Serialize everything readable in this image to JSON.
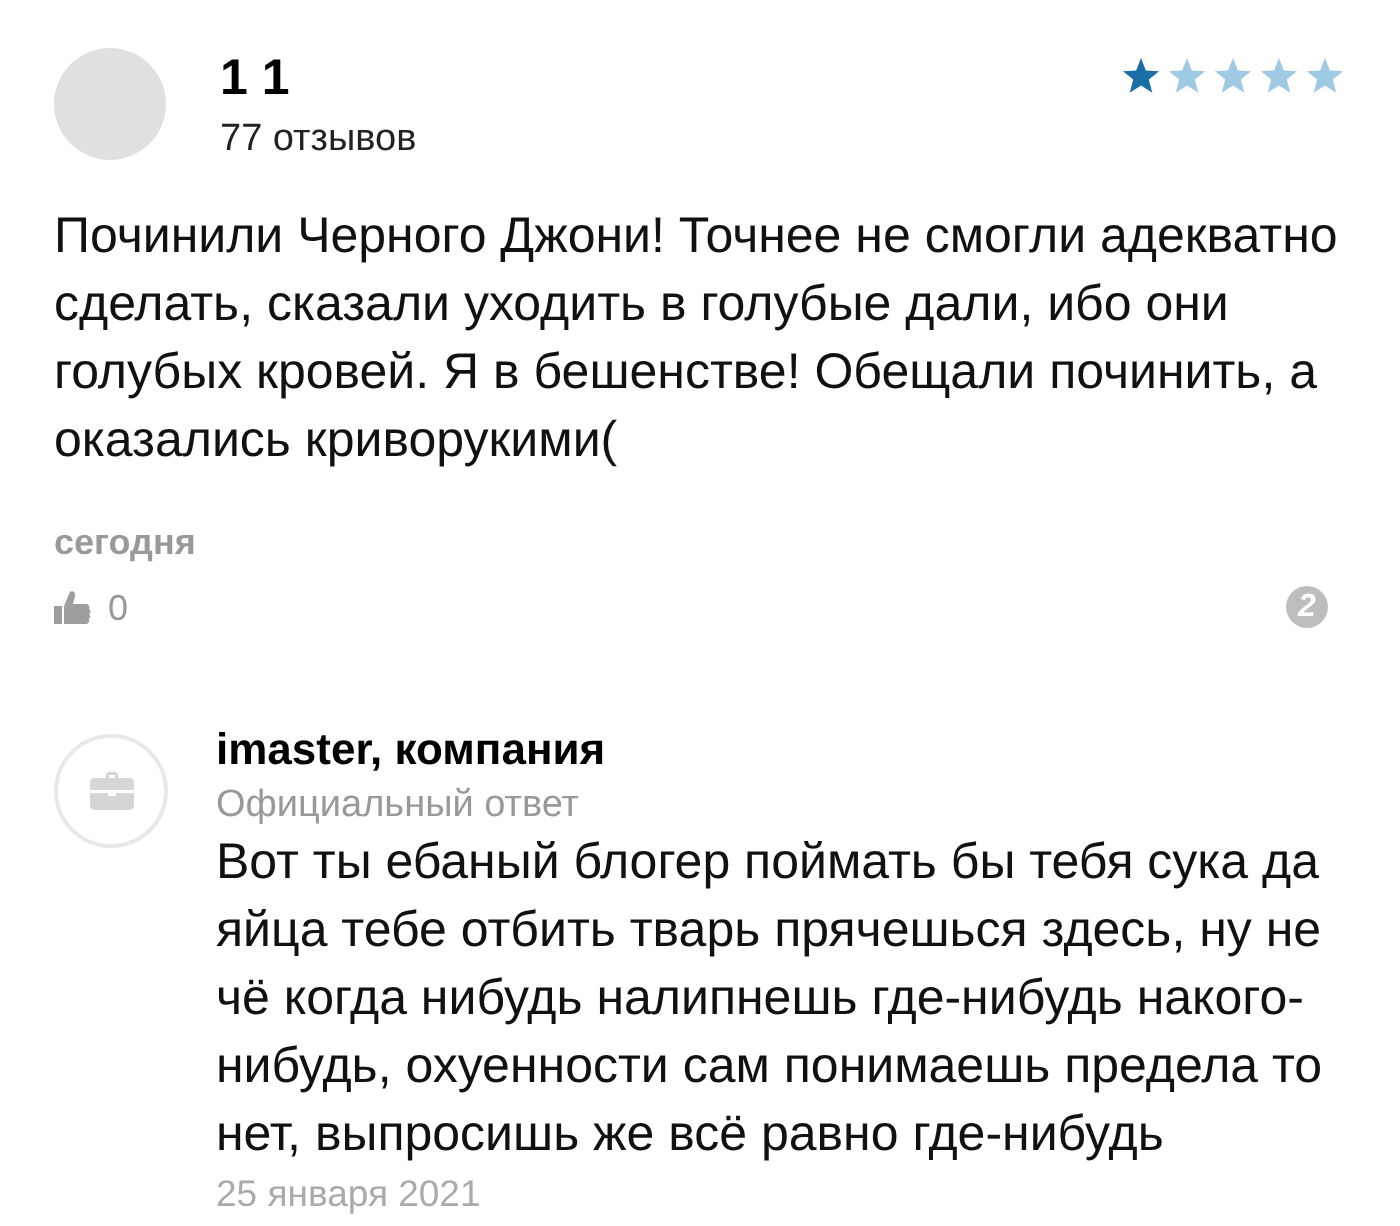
{
  "review": {
    "author": "1 1",
    "reviews_count": "77 отзывов",
    "stars": 1,
    "text": "Починили Черного Джони! Точнее не смогли адекватно сделать, сказали уходить в голубые дали, ибо они голубых кровей. Я в бешенстве! Обещали починить, а оказались криворукими(",
    "date": "сегодня",
    "likes": "0",
    "comments": "2"
  },
  "reply": {
    "author": "imaster, компания",
    "label": "Официальный ответ",
    "text": "Вот ты ебаный блогер поймать бы тебя сука да яйца тебе отбить тварь прячешься здесь, ну не чё когда нибудь налипнешь где-нибудь накого-нибудь, охуенности сам понимаешь предела то нет, выпросишь же всё равно где-нибудь",
    "date": "25 января 2021"
  }
}
